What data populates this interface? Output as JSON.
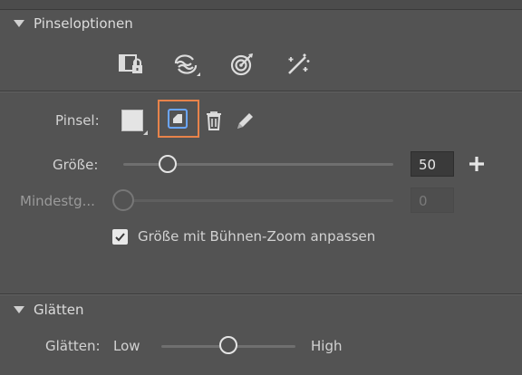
{
  "sections": {
    "brush_options": {
      "title": "Pinseloptionen"
    },
    "smoothing": {
      "title": "Glätten"
    }
  },
  "toolbar_icons": [
    "brush-lock-icon",
    "brush-mode-icon",
    "target-brush-icon",
    "magic-wand-icon"
  ],
  "brush": {
    "label": "Pinsel:",
    "icons": [
      "brush-swatch-icon",
      "new-brush-icon",
      "trash-icon",
      "pencil-icon"
    ]
  },
  "size": {
    "label": "Größe:",
    "value": "50",
    "plus": "+"
  },
  "min_size": {
    "label": "Mindestg...",
    "value": "0"
  },
  "checkbox": {
    "label": "Größe mit Bühnen-Zoom anpassen",
    "checked": true
  },
  "smoothing": {
    "label": "Glätten:",
    "low": "Low",
    "high": "High"
  },
  "colors": {
    "accent": "#e8834a",
    "panel": "#535353"
  }
}
